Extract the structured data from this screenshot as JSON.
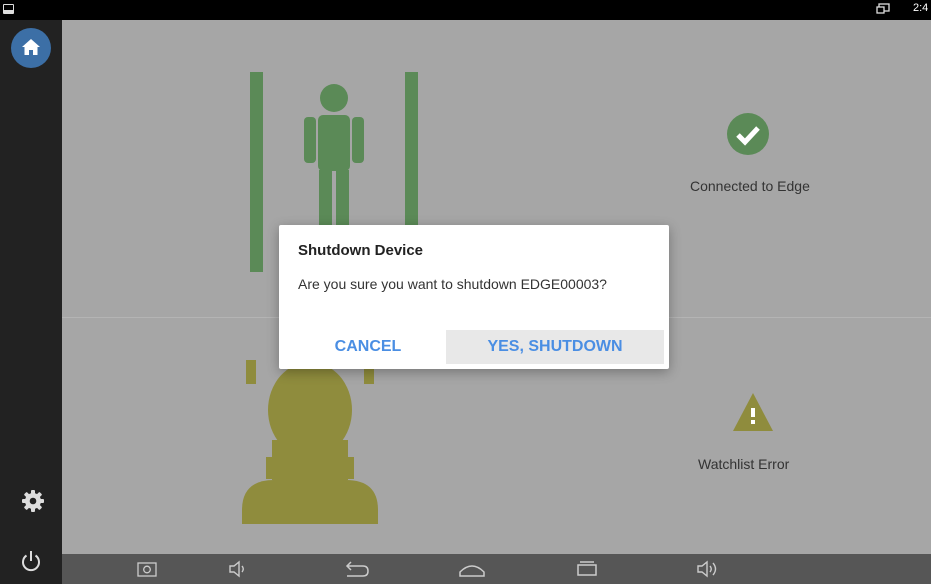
{
  "status_bar": {
    "clock": "2:4",
    "icons": [
      "notification-icon",
      "cast-icon"
    ]
  },
  "sidebar": {
    "icons": [
      "home-icon",
      "gear-icon",
      "power-icon"
    ]
  },
  "tiles": {
    "edge_status": "Connected to Edge",
    "watchlist_status": "Watchlist Error"
  },
  "colors": {
    "background": "#a6a6a6",
    "person_icon": "#5b8a57",
    "face_icon": "#8f8c3d",
    "accent": "#4a8ee3",
    "home_button": "#3c6fa6"
  },
  "dialog": {
    "title": "Shutdown Device",
    "message": "Are you sure you want to shutdown EDGE00003?",
    "cancel_label": "CANCEL",
    "confirm_label": "YES, SHUTDOWN"
  },
  "navbar": {
    "icons": [
      "screenshot-icon",
      "volume-down-icon",
      "back-icon",
      "home-nav-icon",
      "recents-icon",
      "volume-up-icon"
    ]
  }
}
